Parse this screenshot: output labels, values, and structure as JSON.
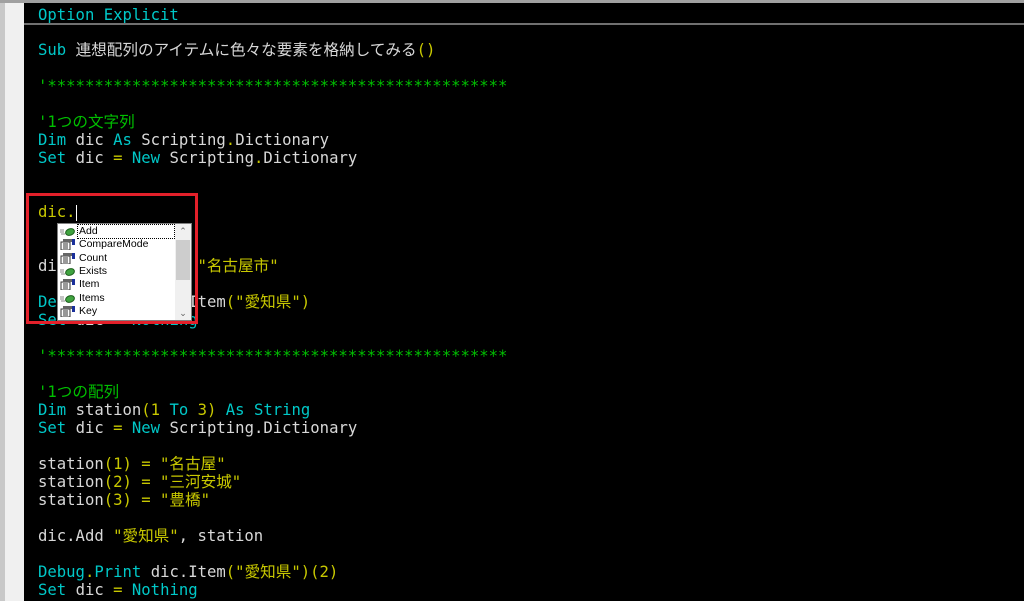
{
  "colors": {
    "keyword": "#00c8c8",
    "text": "#d8d8d8",
    "string": "#c8c800",
    "comment": "#00c000",
    "highlight_box": "#e3202a"
  },
  "editor": {
    "declaration": [
      {
        "t": "Option Explicit",
        "c": "kw"
      }
    ],
    "lines": [
      {
        "row": 1,
        "tokens": [
          {
            "t": "Sub ",
            "c": "kw"
          },
          {
            "t": "連想配列のアイテムに色々な要素を格納してみる",
            "c": "tx"
          },
          {
            "t": "()",
            "c": "st"
          }
        ]
      },
      {
        "row": 3,
        "tokens": [
          {
            "t": "'*************************************************",
            "c": "cm"
          }
        ]
      },
      {
        "row": 5,
        "tokens": [
          {
            "t": "'1つの文字列",
            "c": "cm"
          }
        ]
      },
      {
        "row": 6,
        "tokens": [
          {
            "t": "Dim ",
            "c": "kw"
          },
          {
            "t": "dic ",
            "c": "tx"
          },
          {
            "t": "As ",
            "c": "kw"
          },
          {
            "t": "Scripting",
            "c": "tx"
          },
          {
            "t": ".",
            "c": "st"
          },
          {
            "t": "Dictionary",
            "c": "tx"
          }
        ]
      },
      {
        "row": 7,
        "tokens": [
          {
            "t": "Set ",
            "c": "kw"
          },
          {
            "t": "dic ",
            "c": "tx"
          },
          {
            "t": "= ",
            "c": "st"
          },
          {
            "t": "New ",
            "c": "kw"
          },
          {
            "t": "Scripting",
            "c": "tx"
          },
          {
            "t": ".",
            "c": "st"
          },
          {
            "t": "Dictionary",
            "c": "tx"
          }
        ]
      },
      {
        "row": 10,
        "tokens": [
          {
            "t": "dic.",
            "c": "st"
          }
        ],
        "caret": true
      },
      {
        "row": 13,
        "tokens": [
          {
            "t": "dic.Add ",
            "c": "tx"
          },
          {
            "t": "\"愛知県\", \"名古屋市\"",
            "c": "st"
          }
        ]
      },
      {
        "row": 15,
        "tokens": [
          {
            "t": "Debug",
            "c": "kw"
          },
          {
            "t": ".",
            "c": "st"
          },
          {
            "t": "Print ",
            "c": "kw"
          },
          {
            "t": "dic.Item",
            "c": "tx"
          },
          {
            "t": "(\"愛知県\")",
            "c": "st"
          }
        ]
      },
      {
        "row": 16,
        "tokens": [
          {
            "t": "Set ",
            "c": "kw"
          },
          {
            "t": "dic ",
            "c": "tx"
          },
          {
            "t": "= ",
            "c": "st"
          },
          {
            "t": "Nothing",
            "c": "kw"
          }
        ]
      },
      {
        "row": 18,
        "tokens": [
          {
            "t": "'*************************************************",
            "c": "cm"
          }
        ]
      },
      {
        "row": 20,
        "tokens": [
          {
            "t": "'1つの配列",
            "c": "cm"
          }
        ]
      },
      {
        "row": 21,
        "tokens": [
          {
            "t": "Dim ",
            "c": "kw"
          },
          {
            "t": "station",
            "c": "tx"
          },
          {
            "t": "(1 ",
            "c": "st"
          },
          {
            "t": "To ",
            "c": "kw"
          },
          {
            "t": "3) ",
            "c": "st"
          },
          {
            "t": "As String",
            "c": "kw"
          }
        ]
      },
      {
        "row": 22,
        "tokens": [
          {
            "t": "Set ",
            "c": "kw"
          },
          {
            "t": "dic ",
            "c": "tx"
          },
          {
            "t": "= ",
            "c": "st"
          },
          {
            "t": "New ",
            "c": "kw"
          },
          {
            "t": "Scripting.Dictionary",
            "c": "tx"
          }
        ]
      },
      {
        "row": 24,
        "tokens": [
          {
            "t": "station",
            "c": "tx"
          },
          {
            "t": "(1) = \"名古屋\"",
            "c": "st"
          }
        ]
      },
      {
        "row": 25,
        "tokens": [
          {
            "t": "station",
            "c": "tx"
          },
          {
            "t": "(2) = \"三河安城\"",
            "c": "st"
          }
        ]
      },
      {
        "row": 26,
        "tokens": [
          {
            "t": "station",
            "c": "tx"
          },
          {
            "t": "(3) = \"豊橋\"",
            "c": "st"
          }
        ]
      },
      {
        "row": 28,
        "tokens": [
          {
            "t": "dic.Add ",
            "c": "tx"
          },
          {
            "t": "\"愛知県\"",
            "c": "st"
          },
          {
            "t": ", station",
            "c": "tx"
          }
        ]
      },
      {
        "row": 30,
        "tokens": [
          {
            "t": "Debug",
            "c": "kw"
          },
          {
            "t": ".",
            "c": "st"
          },
          {
            "t": "Print ",
            "c": "kw"
          },
          {
            "t": "dic.Item",
            "c": "tx"
          },
          {
            "t": "(\"愛知県\")(2)",
            "c": "st"
          }
        ]
      },
      {
        "row": 31,
        "tokens": [
          {
            "t": "Set ",
            "c": "kw"
          },
          {
            "t": "dic ",
            "c": "tx"
          },
          {
            "t": "= ",
            "c": "st"
          },
          {
            "t": "Nothing",
            "c": "kw"
          }
        ]
      }
    ]
  },
  "autocomplete": {
    "selected": "Add",
    "items": [
      {
        "label": "Add",
        "icon": "method-icon"
      },
      {
        "label": "CompareMode",
        "icon": "property-icon"
      },
      {
        "label": "Count",
        "icon": "property-icon"
      },
      {
        "label": "Exists",
        "icon": "method-icon"
      },
      {
        "label": "Item",
        "icon": "property-icon"
      },
      {
        "label": "Items",
        "icon": "method-icon"
      },
      {
        "label": "Key",
        "icon": "property-icon"
      }
    ]
  }
}
